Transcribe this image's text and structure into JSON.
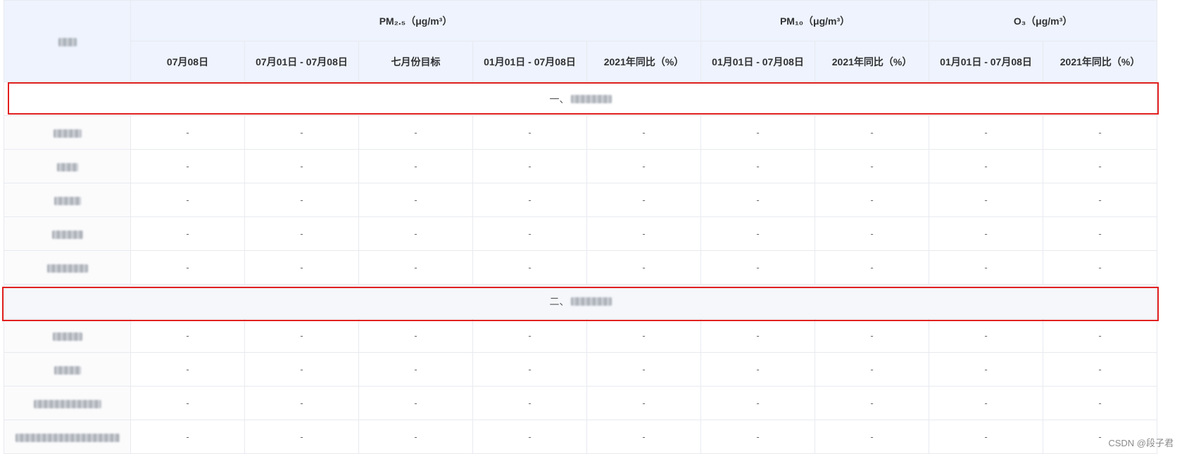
{
  "header": {
    "corner_label_blurred": true,
    "groups": [
      {
        "label": "PM₂.₅（μg/m³）",
        "span": 5
      },
      {
        "label": "PM₁₀（μg/m³）",
        "span": 2
      },
      {
        "label": "O₃（μg/m³）",
        "span": 2
      }
    ],
    "columns": [
      "07月08日",
      "07月01日 - 07月08日",
      "七月份目标",
      "01月01日 - 07月08日",
      "2021年同比（%）",
      "01月01日 - 07月08日",
      "2021年同比（%）",
      "01月01日 - 07月08日",
      "2021年同比（%）"
    ]
  },
  "sections": [
    {
      "prefix": "一、",
      "highlighted": true,
      "rows": [
        {
          "name_blurred": true,
          "cells": [
            "-",
            "-",
            "-",
            "-",
            "-",
            "-",
            "-",
            "-",
            "-"
          ]
        },
        {
          "name_blurred": true,
          "cells": [
            "-",
            "-",
            "-",
            "-",
            "-",
            "-",
            "-",
            "-",
            "-"
          ]
        },
        {
          "name_blurred": true,
          "cells": [
            "-",
            "-",
            "-",
            "-",
            "-",
            "-",
            "-",
            "-",
            "-"
          ]
        },
        {
          "name_blurred": true,
          "cells": [
            "-",
            "-",
            "-",
            "-",
            "-",
            "-",
            "-",
            "-",
            "-"
          ]
        },
        {
          "name_blurred": true,
          "cells": [
            "-",
            "-",
            "-",
            "-",
            "-",
            "-",
            "-",
            "-",
            "-"
          ]
        }
      ]
    },
    {
      "prefix": "二、",
      "highlighted": true,
      "rows": [
        {
          "name_blurred": true,
          "cells": [
            "-",
            "-",
            "-",
            "-",
            "-",
            "-",
            "-",
            "-",
            "-"
          ]
        },
        {
          "name_blurred": true,
          "cells": [
            "-",
            "-",
            "-",
            "-",
            "-",
            "-",
            "-",
            "-",
            "-"
          ]
        },
        {
          "name_blurred": true,
          "cells": [
            "-",
            "-",
            "-",
            "-",
            "-",
            "-",
            "-",
            "-",
            "-"
          ]
        },
        {
          "name_blurred": true,
          "cells": [
            "-",
            "-",
            "-",
            "-",
            "-",
            "-",
            "-",
            "-",
            "-"
          ]
        }
      ]
    }
  ],
  "watermark": "CSDN @段子君",
  "colors": {
    "header_bg": "#eef3fd",
    "border": "#e8eaef",
    "highlight_box": "#e1201f"
  }
}
